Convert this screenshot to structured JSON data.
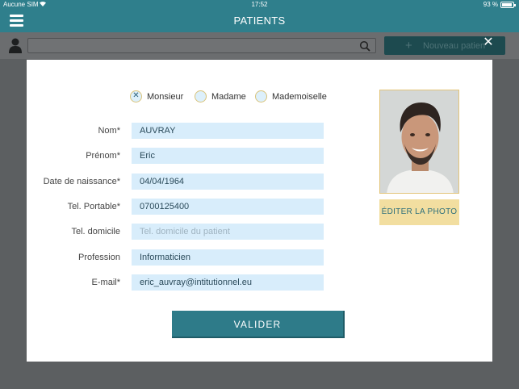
{
  "status_bar": {
    "carrier": "Aucune SIM",
    "time": "17:52",
    "battery": "93 %",
    "battery_level": 0.93
  },
  "nav": {
    "title": "PATIENTS"
  },
  "toolbar": {
    "search_placeholder": "",
    "new_patient_label": "Nouveau patien"
  },
  "modal": {
    "civility": [
      {
        "label": "Monsieur",
        "selected": true
      },
      {
        "label": "Madame",
        "selected": false
      },
      {
        "label": "Mademoiselle",
        "selected": false
      }
    ],
    "fields": {
      "nom": {
        "label": "Nom*",
        "value": "AUVRAY",
        "placeholder": ""
      },
      "prenom": {
        "label": "Prénom*",
        "value": "Eric",
        "placeholder": ""
      },
      "naissance": {
        "label": "Date de naissance*",
        "value": "04/04/1964",
        "placeholder": ""
      },
      "portable": {
        "label": "Tel. Portable*",
        "value": "0700125400",
        "placeholder": ""
      },
      "domicile": {
        "label": "Tel. domicile",
        "value": "",
        "placeholder": "Tel. domicile du patient"
      },
      "profession": {
        "label": "Profession",
        "value": "Informaticien",
        "placeholder": ""
      },
      "email": {
        "label": "E-mail*",
        "value": "eric_auvray@intitutionnel.eu",
        "placeholder": ""
      }
    },
    "edit_photo_label": "ÉDITER LA PHOTO",
    "validate_label": "VALIDER"
  },
  "colors": {
    "brand": "#2f7f8c",
    "field_bg": "#d8edfb",
    "accent_gold": "#f2dea0"
  }
}
